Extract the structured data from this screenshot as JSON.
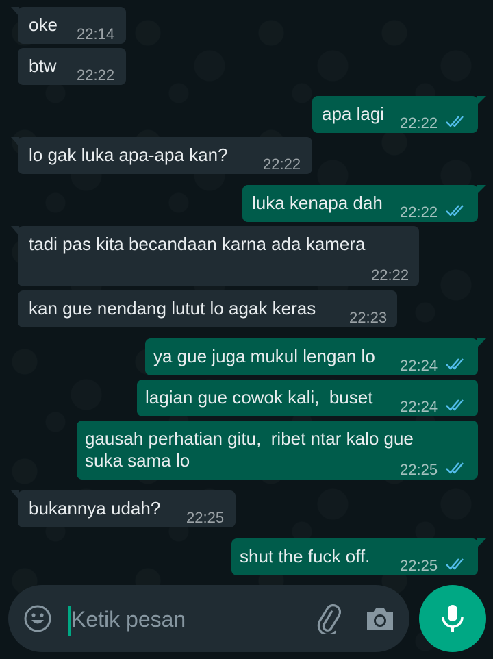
{
  "messages": [
    {
      "dir": "in",
      "text": "oke",
      "time": "22:14"
    },
    {
      "dir": "in",
      "text": "btw",
      "time": "22:22"
    },
    {
      "dir": "out",
      "text": "apa lagi",
      "time": "22:22",
      "status": "read"
    },
    {
      "dir": "in",
      "text": "lo gak luka apa-apa kan?",
      "time": "22:22"
    },
    {
      "dir": "out",
      "text": "luka kenapa dah",
      "time": "22:22",
      "status": "read"
    },
    {
      "dir": "in",
      "text": "tadi pas kita becandaan karna ada kamera",
      "time": "22:22"
    },
    {
      "dir": "in",
      "text": "kan gue nendang lutut lo agak keras",
      "time": "22:23"
    },
    {
      "dir": "out",
      "text": "ya gue juga mukul lengan lo",
      "time": "22:24",
      "status": "read"
    },
    {
      "dir": "out",
      "text": "lagian gue cowok kali,  buset",
      "time": "22:24",
      "status": "read"
    },
    {
      "dir": "out",
      "text": "gausah perhatian gitu,  ribet ntar kalo gue\nsuka sama lo",
      "time": "22:25",
      "status": "read"
    },
    {
      "dir": "in",
      "text": "bukannya udah?",
      "time": "22:25"
    },
    {
      "dir": "out",
      "text": "shut the fuck off.",
      "time": "22:25",
      "status": "read"
    }
  ],
  "composer": {
    "placeholder": "Ketik pesan",
    "emoji_icon": "emoji-icon",
    "attach_icon": "paperclip-icon",
    "camera_icon": "camera-icon",
    "mic_icon": "microphone-icon"
  },
  "colors": {
    "incoming_bubble": "#202c33",
    "outgoing_bubble": "#005c4b",
    "read_ticks": "#53bdeb",
    "accent": "#00a884"
  }
}
